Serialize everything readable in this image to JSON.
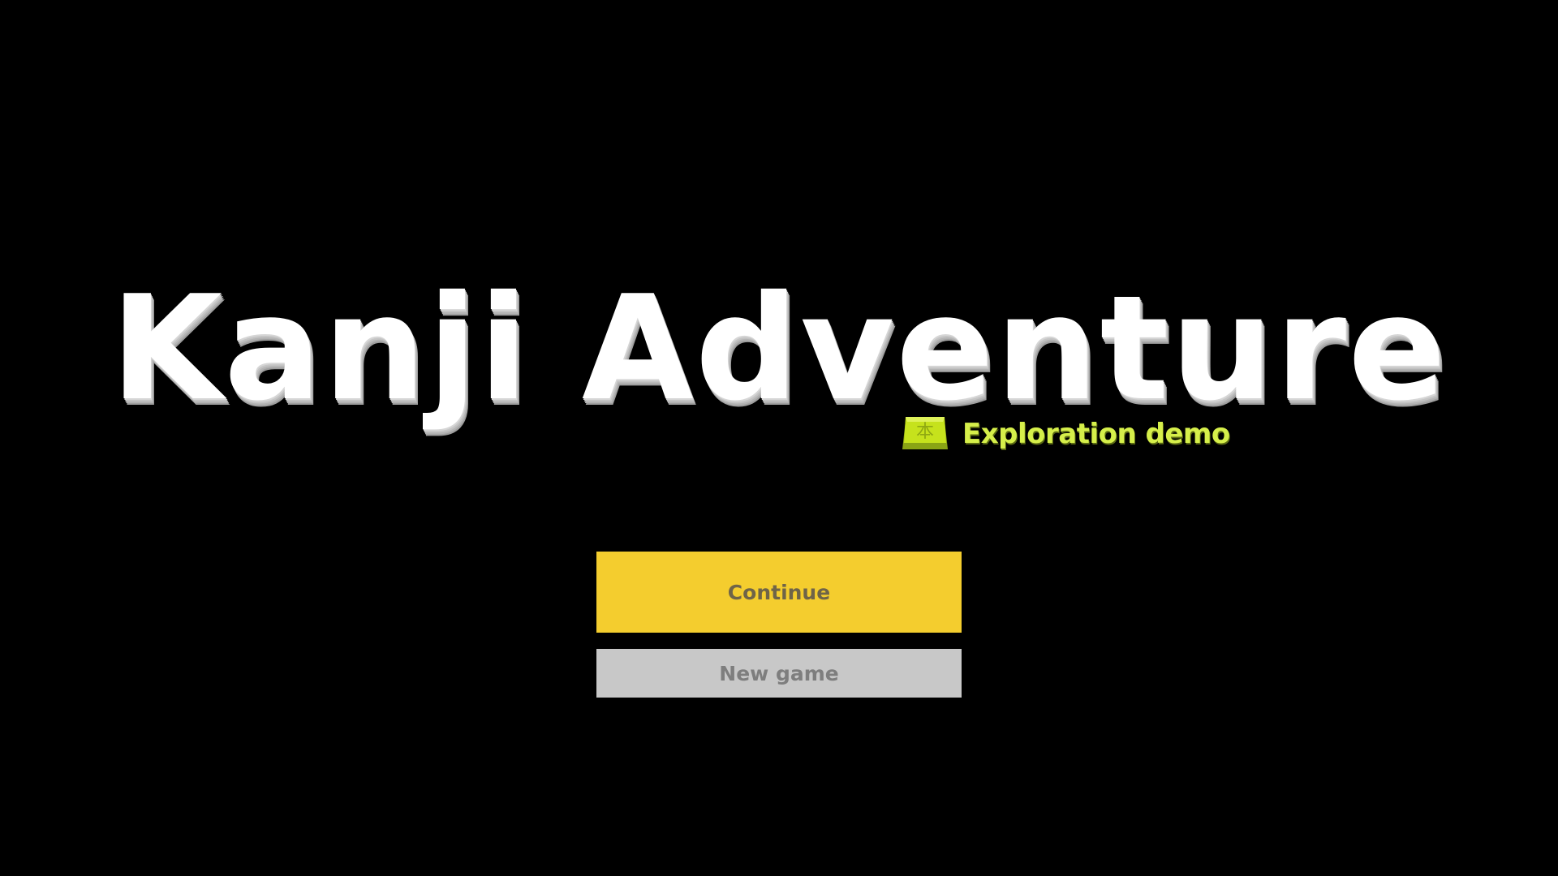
{
  "title": "Kanji Adventure",
  "subtitle": {
    "icon": "kanji-key-icon",
    "icon_glyph": "本",
    "text": "Exploration demo"
  },
  "menu": {
    "continue_label": "Continue",
    "new_game_label": "New game"
  },
  "colors": {
    "background": "#000000",
    "title": "#ffffff",
    "subtitle": "#d6ef4a",
    "continue_button": "#f4cd2e",
    "new_game_button": "#c8c8c8"
  }
}
